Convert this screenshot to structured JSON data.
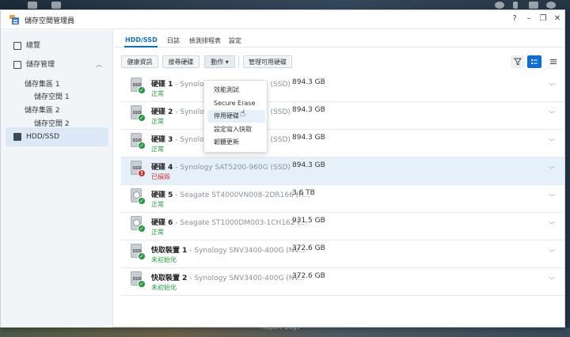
{
  "window": {
    "title": "儲存空間管理員"
  },
  "sidebar": {
    "overview": "總覽",
    "storage": "儲存管理",
    "pool1": "儲存集區 1",
    "volume1": "儲存空間 1",
    "pool2": "儲存集區 2",
    "volume2": "儲存空間 2",
    "hdd": "HDD/SSD"
  },
  "tabs": [
    "HDD/SSD",
    "日誌",
    "檢測排程表",
    "設定"
  ],
  "toolbar": {
    "health": "健康資訊",
    "search": "搜尋硬碟",
    "action": "動作",
    "manage": "管理可用硬碟"
  },
  "dropdown": [
    "效能測試",
    "Secure Erase",
    "停用硬碟",
    "設定寫入快取",
    "韌體更新"
  ],
  "disks": [
    {
      "name": "硬碟 1",
      "model": " - Synology SAT5200-960G (SSD)",
      "capacity": "894.3 GB",
      "status": "正常",
      "type": "ssd",
      "state": "ok"
    },
    {
      "name": "硬碟 2",
      "model": " - Synology SAT5200-960G (SSD)",
      "capacity": "894.3 GB",
      "status": "正常",
      "type": "ssd",
      "state": "ok"
    },
    {
      "name": "硬碟 3",
      "model": " - Synology SAT5200-960G (SSD)",
      "capacity": "894.3 GB",
      "status": "正常",
      "type": "ssd",
      "state": "ok"
    },
    {
      "name": "硬碟 4",
      "model": " - Synology SAT5200-960G (SSD)",
      "capacity": "894.3 GB",
      "status": "已損毀",
      "type": "ssd",
      "state": "bad"
    },
    {
      "name": "硬碟 5",
      "model": " - Seagate ST4000VN008-2DR166 (H...",
      "capacity": "3.6 TB",
      "status": "正常",
      "type": "hdd",
      "state": "ok"
    },
    {
      "name": "硬碟 6",
      "model": " - Seagate ST1000DM003-1CH162 (...",
      "capacity": "931.5 GB",
      "status": "正常",
      "type": "hdd",
      "state": "ok"
    },
    {
      "name": "快取裝置 1",
      "model": " - Synology SNV3400-400G (NV...",
      "capacity": "372.6 GB",
      "status": "未初始化",
      "type": "ssd",
      "state": "ok"
    },
    {
      "name": "快取裝置 2",
      "model": " - Synology SNV3400-400G (NV...",
      "capacity": "372.6 GB",
      "status": "未初始化",
      "type": "ssd",
      "state": "ok"
    }
  ],
  "desktop": {
    "report": "Report Bugs"
  },
  "colors": {
    "accent": "#0b6ed8",
    "ok": "#1e9c3a",
    "bad": "#d9302e"
  }
}
